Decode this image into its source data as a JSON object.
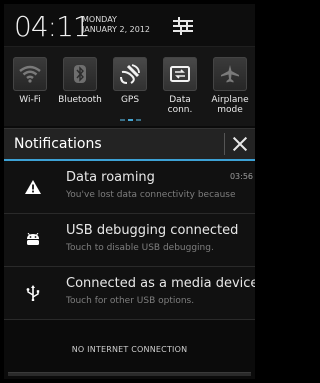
{
  "header": {
    "time": "04:11",
    "date_line1": "MONDAY",
    "date_line2": "JANUARY 2, 2012"
  },
  "toggles": [
    {
      "label": "Wi-Fi",
      "icon": "wifi-icon",
      "active": false
    },
    {
      "label": "Bluetooth",
      "icon": "bluetooth-icon",
      "active": false
    },
    {
      "label": "GPS",
      "icon": "gps-icon",
      "active": true
    },
    {
      "label": "Data\nconn.",
      "icon": "data-connection-icon",
      "active": true
    },
    {
      "label": "Airplane\nmode",
      "icon": "airplane-icon",
      "active": false
    }
  ],
  "notifications_header": {
    "title": "Notifications"
  },
  "notifications": [
    {
      "title": "Data roaming",
      "subtitle": "You've lost data connectivity because",
      "time": "03:56",
      "icon": "warning-icon"
    },
    {
      "title": "USB debugging connected",
      "subtitle": "Touch to disable USB debugging.",
      "time": "",
      "icon": "android-icon"
    },
    {
      "title": "Connected as a media device",
      "subtitle": "Touch for other USB options.",
      "time": "",
      "icon": "usb-icon"
    }
  ],
  "footer": {
    "status": "NO INTERNET CONNECTION"
  },
  "colors": {
    "accent": "#3da2d6",
    "background": "#0b0b0b"
  }
}
